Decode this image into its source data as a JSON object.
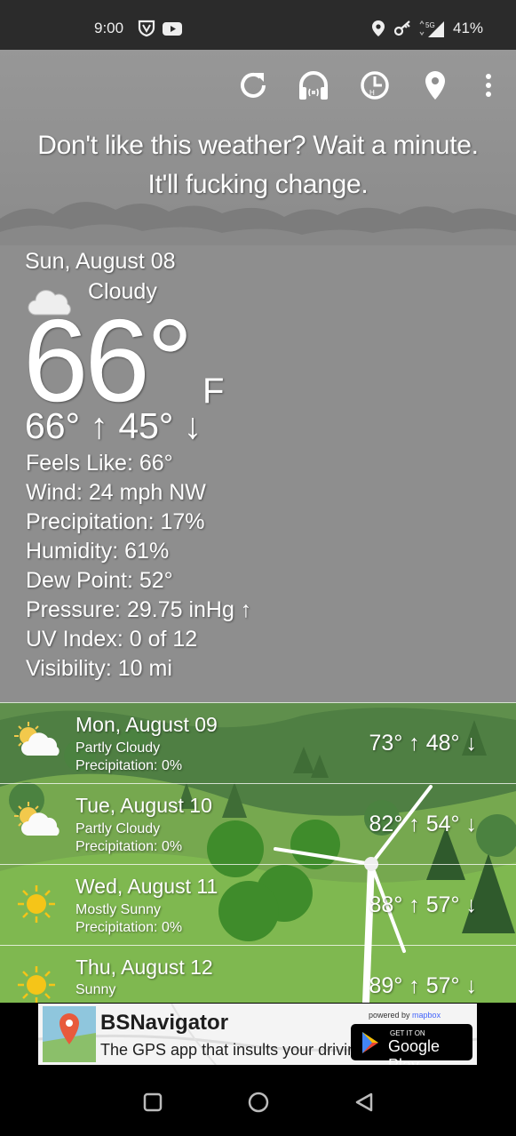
{
  "status_bar": {
    "time": "9:00",
    "network": "5G",
    "battery": "41%"
  },
  "toolbar": {
    "icons": [
      "refresh-icon",
      "radar-icon",
      "history-icon",
      "location-icon",
      "more-icon"
    ]
  },
  "tagline": {
    "line1": "Don't like this weather? Wait a minute.",
    "line2": "It'll fucking change."
  },
  "today": {
    "date": "Sun, August 08",
    "condition": "Cloudy",
    "temp": "66°",
    "unit": "F",
    "high": "66°",
    "low": "45°",
    "details": [
      {
        "label": "Feels Like:",
        "value": "66°"
      },
      {
        "label": "Wind:",
        "value": "24 mph NW"
      },
      {
        "label": "Precipitation:",
        "value": "17%"
      },
      {
        "label": "Humidity:",
        "value": "61%"
      },
      {
        "label": "Dew Point:",
        "value": "52°"
      },
      {
        "label": "Pressure:",
        "value": "29.75 inHg ↑"
      },
      {
        "label": "UV Index:",
        "value": "0 of 12"
      },
      {
        "label": "Visibility:",
        "value": "10 mi"
      }
    ]
  },
  "forecast": [
    {
      "day": "Mon, August 09",
      "condition": "Partly Cloudy",
      "precip_label": "Precipitation:",
      "precip": "0%",
      "high": "73°",
      "low": "48°",
      "icon": "partly-cloudy-icon"
    },
    {
      "day": "Tue, August 10",
      "condition": "Partly Cloudy",
      "precip_label": "Precipitation:",
      "precip": "0%",
      "high": "82°",
      "low": "54°",
      "icon": "partly-cloudy-icon"
    },
    {
      "day": "Wed, August 11",
      "condition": "Mostly Sunny",
      "precip_label": "Precipitation:",
      "precip": "0%",
      "high": "88°",
      "low": "57°",
      "icon": "sunny-icon"
    },
    {
      "day": "Thu, August 12",
      "condition": "Sunny",
      "precip_label": "",
      "precip": "",
      "high": "89°",
      "low": "57°",
      "icon": "sunny-icon"
    }
  ],
  "ad": {
    "title": "BSNavigator",
    "subtitle": "The GPS app that insults your driving.",
    "powered_by": "powered by",
    "mapbox": "mapbox",
    "store_small": "GET IT ON",
    "store_big": "Google Play"
  }
}
